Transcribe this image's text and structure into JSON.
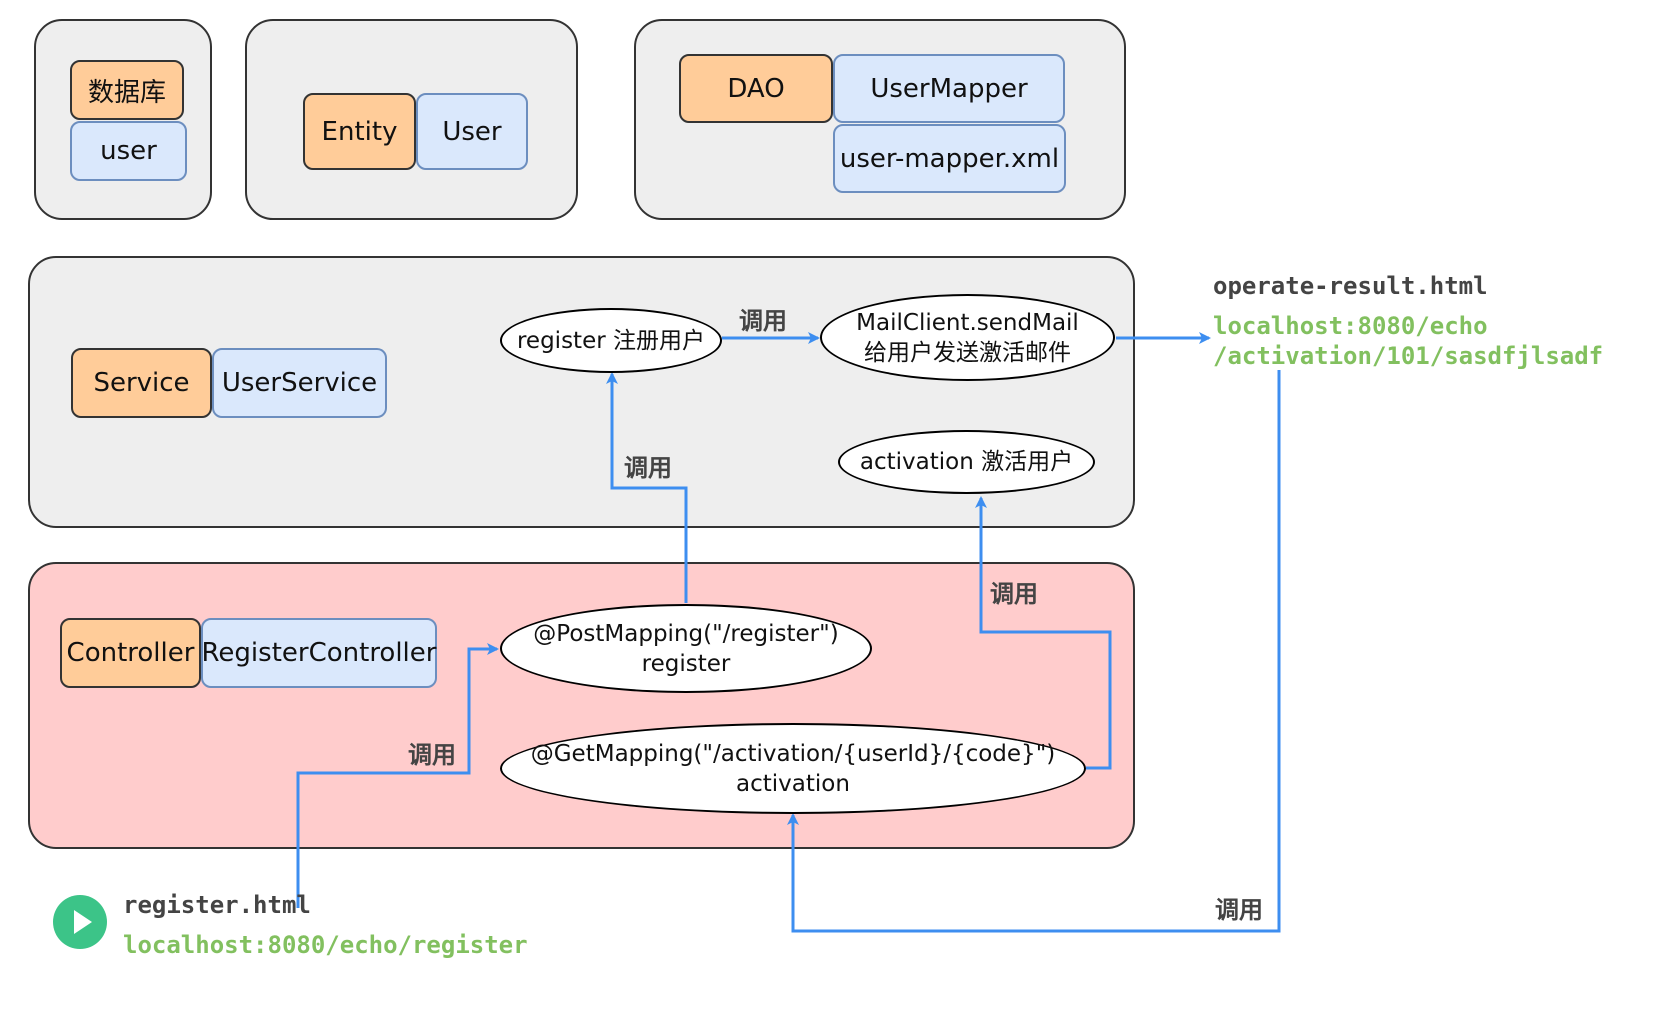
{
  "colors": {
    "panel_fill": "#eeeeee",
    "controller_panel_fill": "#ffcccc",
    "layer_fill": "#ffcc99",
    "class_fill": "#dae8fc",
    "class_border": "#6c8ebf",
    "arrow": "#3d8ef0",
    "url_text": "#82c05f",
    "play_icon": "#3cc488"
  },
  "database": {
    "layer": "数据库",
    "table": "user"
  },
  "entity": {
    "layer": "Entity",
    "class": "User"
  },
  "dao": {
    "layer": "DAO",
    "mapper": "UserMapper",
    "xml": "user-mapper.xml"
  },
  "service": {
    "layer": "Service",
    "class": "UserService",
    "register": "register 注册用户",
    "mail_line1": "MailClient.sendMail",
    "mail_line2": "给用户发送激活邮件",
    "activation": "activation 激活用户"
  },
  "controller": {
    "layer": "Controller",
    "class": "RegisterController",
    "post_line1": "@PostMapping(\"/register\")",
    "post_line2": "register",
    "get_line1": "@GetMapping(\"/activation/{userId}/{code}\")",
    "get_line2": "activation"
  },
  "call_label": "调用",
  "operate_result": {
    "file": "operate-result.html",
    "url_line1": "localhost:8080/echo",
    "url_line2": "/activation/101/sasdfjlsadf"
  },
  "register_page": {
    "file": "register.html",
    "url": "localhost:8080/echo/register",
    "icon": "play-icon"
  }
}
